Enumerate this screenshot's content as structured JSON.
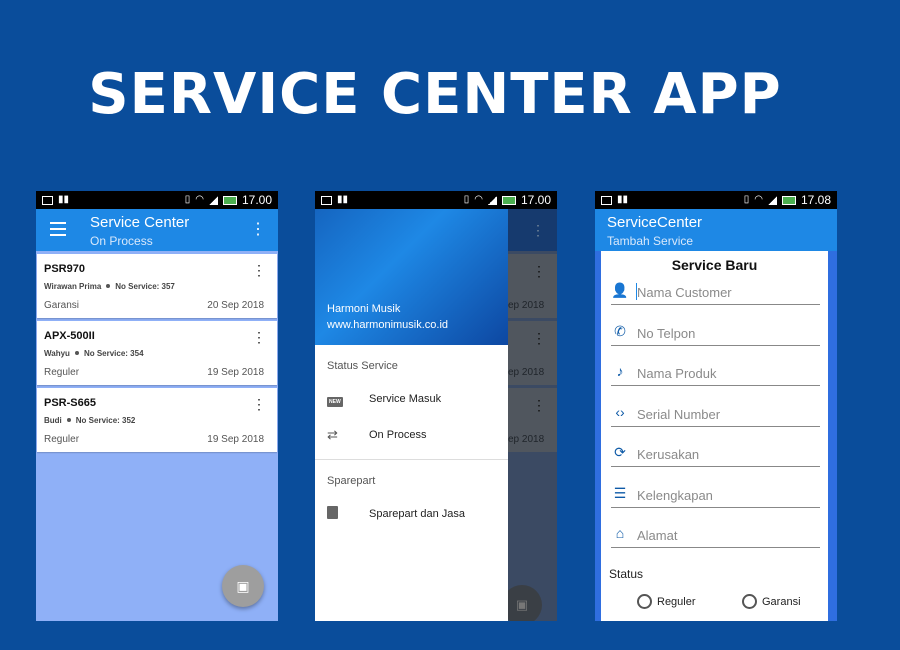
{
  "headline": "SERVICE CENTER APP",
  "colors": {
    "background": "#0a4d9b",
    "appbar": "#1e88e5",
    "list_bg": "#8fb0f7",
    "fab": "#9e9e9e"
  },
  "status_bar": {
    "time_1": "17.00",
    "time_2": "17.00",
    "time_3": "17.08"
  },
  "screen1": {
    "title": "Service Center",
    "subtitle": "On Process",
    "cards": [
      {
        "name": "PSR970",
        "customer": "Wirawan Prima",
        "service_no": "No Service: 357",
        "type": "Garansi",
        "date": "20 Sep 2018"
      },
      {
        "name": "APX-500II",
        "customer": "Wahyu",
        "service_no": "No Service: 354",
        "type": "Reguler",
        "date": "19 Sep 2018"
      },
      {
        "name": "PSR-S665",
        "customer": "Budi",
        "service_no": "No Service: 352",
        "type": "Reguler",
        "date": "19 Sep 2018"
      }
    ],
    "fab_icon": "add-document-icon"
  },
  "screen2": {
    "drawer_name": "Harmoni Musik",
    "drawer_website": "www.harmonimusik.co.id",
    "section_status": "Status Service",
    "item_service_masuk": "Service Masuk",
    "item_on_process": "On Process",
    "section_sparepart": "Sparepart",
    "item_sparepart_jasa": "Sparepart dan Jasa",
    "behind_dates": [
      "ep 2018",
      "ep 2018",
      "ep 2018"
    ]
  },
  "screen3": {
    "title": "ServiceCenter",
    "subtitle": "Tambah Service",
    "form_title": "Service Baru",
    "fields": [
      "Nama Customer",
      "No Telpon",
      "Nama Produk",
      "Serial Number",
      "Kerusakan",
      "Kelengkapan",
      "Alamat"
    ],
    "status_label": "Status",
    "radio_reguler": "Reguler",
    "radio_garansi": "Garansi"
  }
}
